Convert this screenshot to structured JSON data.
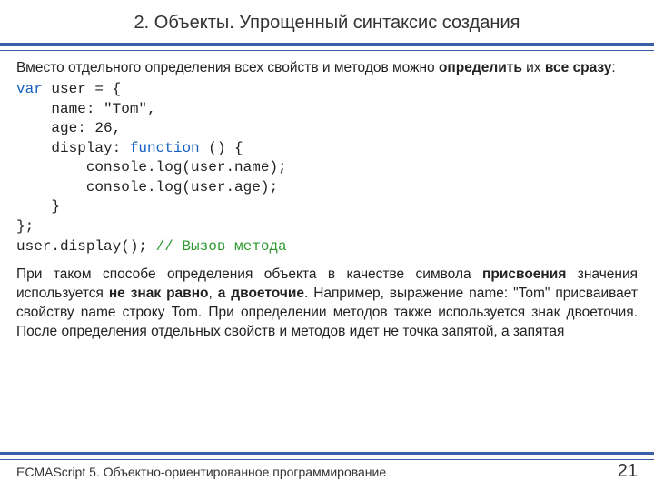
{
  "title": "2. Объекты. Упрощенный синтаксис создания",
  "intro": {
    "t1": "Вместо отдельного определения всех свойств и методов можно ",
    "b1": "определить",
    "t2": " их ",
    "b2": "все сразу",
    "t3": ":"
  },
  "code": {
    "l1a": "var",
    "l1b": " user = {",
    "l2": "    name: \"Tom\",",
    "l3": "    age: 26,",
    "l4a": "    display: ",
    "l4b": "function",
    "l4c": " () {",
    "l5": "        console.log(user.name);",
    "l6": "        console.log(user.age);",
    "l7": "    }",
    "l8": "};",
    "l9a": "user.display(); ",
    "l9b": "// Вызов метода"
  },
  "para": {
    "t1": "При таком способе определения объекта в качестве символа ",
    "b1": "присвоения",
    "t2": " значения используется ",
    "b2": "не знак равно",
    "t3": ", ",
    "b3": "а двоеточие",
    "t4": ". Например, выражение name: \"Tom\" присваивает свойству name строку Tom. При определении методов также используется знак двоеточия. После определения отдельных свойств и методов идет не точка запятой, а запятая"
  },
  "footer": "ECMAScript 5. Объектно-ориентированное программирование",
  "page_number": "21"
}
